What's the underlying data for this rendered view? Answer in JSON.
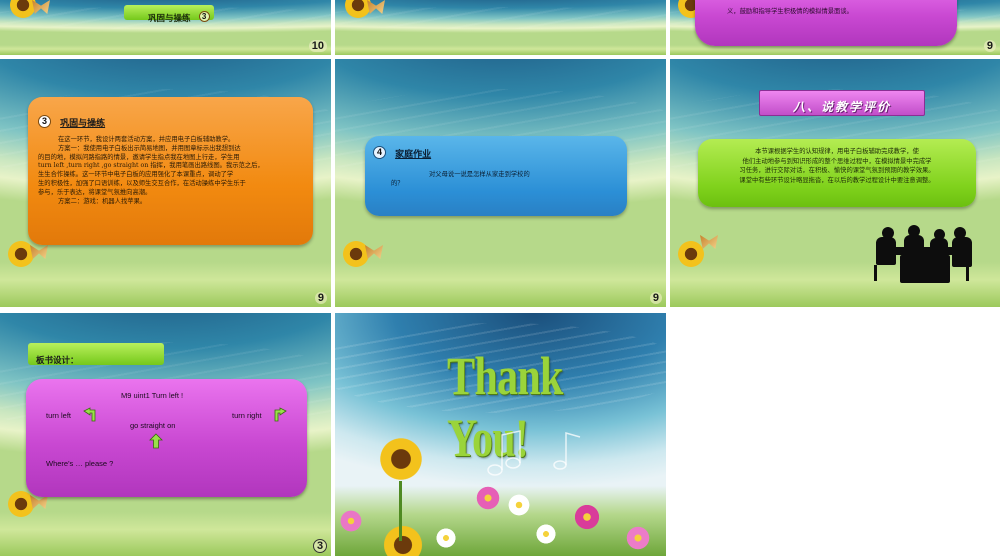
{
  "slides": {
    "s1": {
      "tag": "巩固与操练",
      "tag_num": "3",
      "page": "10"
    },
    "s2": {
      "page": ""
    },
    "s3": {
      "top_text": "义，鼓励和指导学生积极情的模拟情景面谈。",
      "page": "9"
    },
    "s4": {
      "num": "3",
      "heading": "巩固与操练",
      "lines": [
        "在这一环节，我设计两套活动方案，并应用电子白板辅助教学。",
        "方案一：我使用电子白板出示简易地图，并用图章标示出我想到达",
        "的目的地，模拟问路指路的情景，邀请学生指点我在地图上行走，学生用",
        "turn left ,turn right ,go straight on 指挥，我用笔画出路线图。我示范之后，",
        "生生合作操练。这一环节中电子白板的应用强化了本课重点，调动了学",
        "生的积极性，加强了口语训练，以及师生交互合作，在活动操练中学生乐于",
        "参与，乐于表达，将课堂气氛推向高潮。",
        "方案二：游戏：机器人找苹果。"
      ],
      "page": "9"
    },
    "s5": {
      "num": "4",
      "heading": "家庭作业",
      "lines": [
        "对父母说一说是怎样从家走到学校的",
        "的？"
      ],
      "page": "9"
    },
    "s6": {
      "tag": "八、说教学评价",
      "lines": [
        "本节课根据学生的认知规律，用电子白板辅助完成教学，使",
        "他们主动地参与到知识形成的整个思维过程中，在模拟情景中完成学",
        "习任务，进行交际对话，在积极、愉快的课堂气氛到预期的教学效果。",
        "课堂中有些环节设计略显拖沓，在以后的教学过程设计中要注意调整。"
      ]
    },
    "s7": {
      "tag": "板书设计：",
      "title": "M9 uint1 Turn left !",
      "turn_left": "turn left",
      "turn_right": "turn right",
      "go_straight": "go straight on",
      "where": "Where's … please ?",
      "page": "3"
    },
    "s8": {
      "thank": "Thank You!"
    }
  },
  "colors": {
    "orange": "#f28a10",
    "blue": "#2b8fd6",
    "green": "#80d21c",
    "purple": "#c948d2",
    "thank_green": "#9ad43a"
  }
}
